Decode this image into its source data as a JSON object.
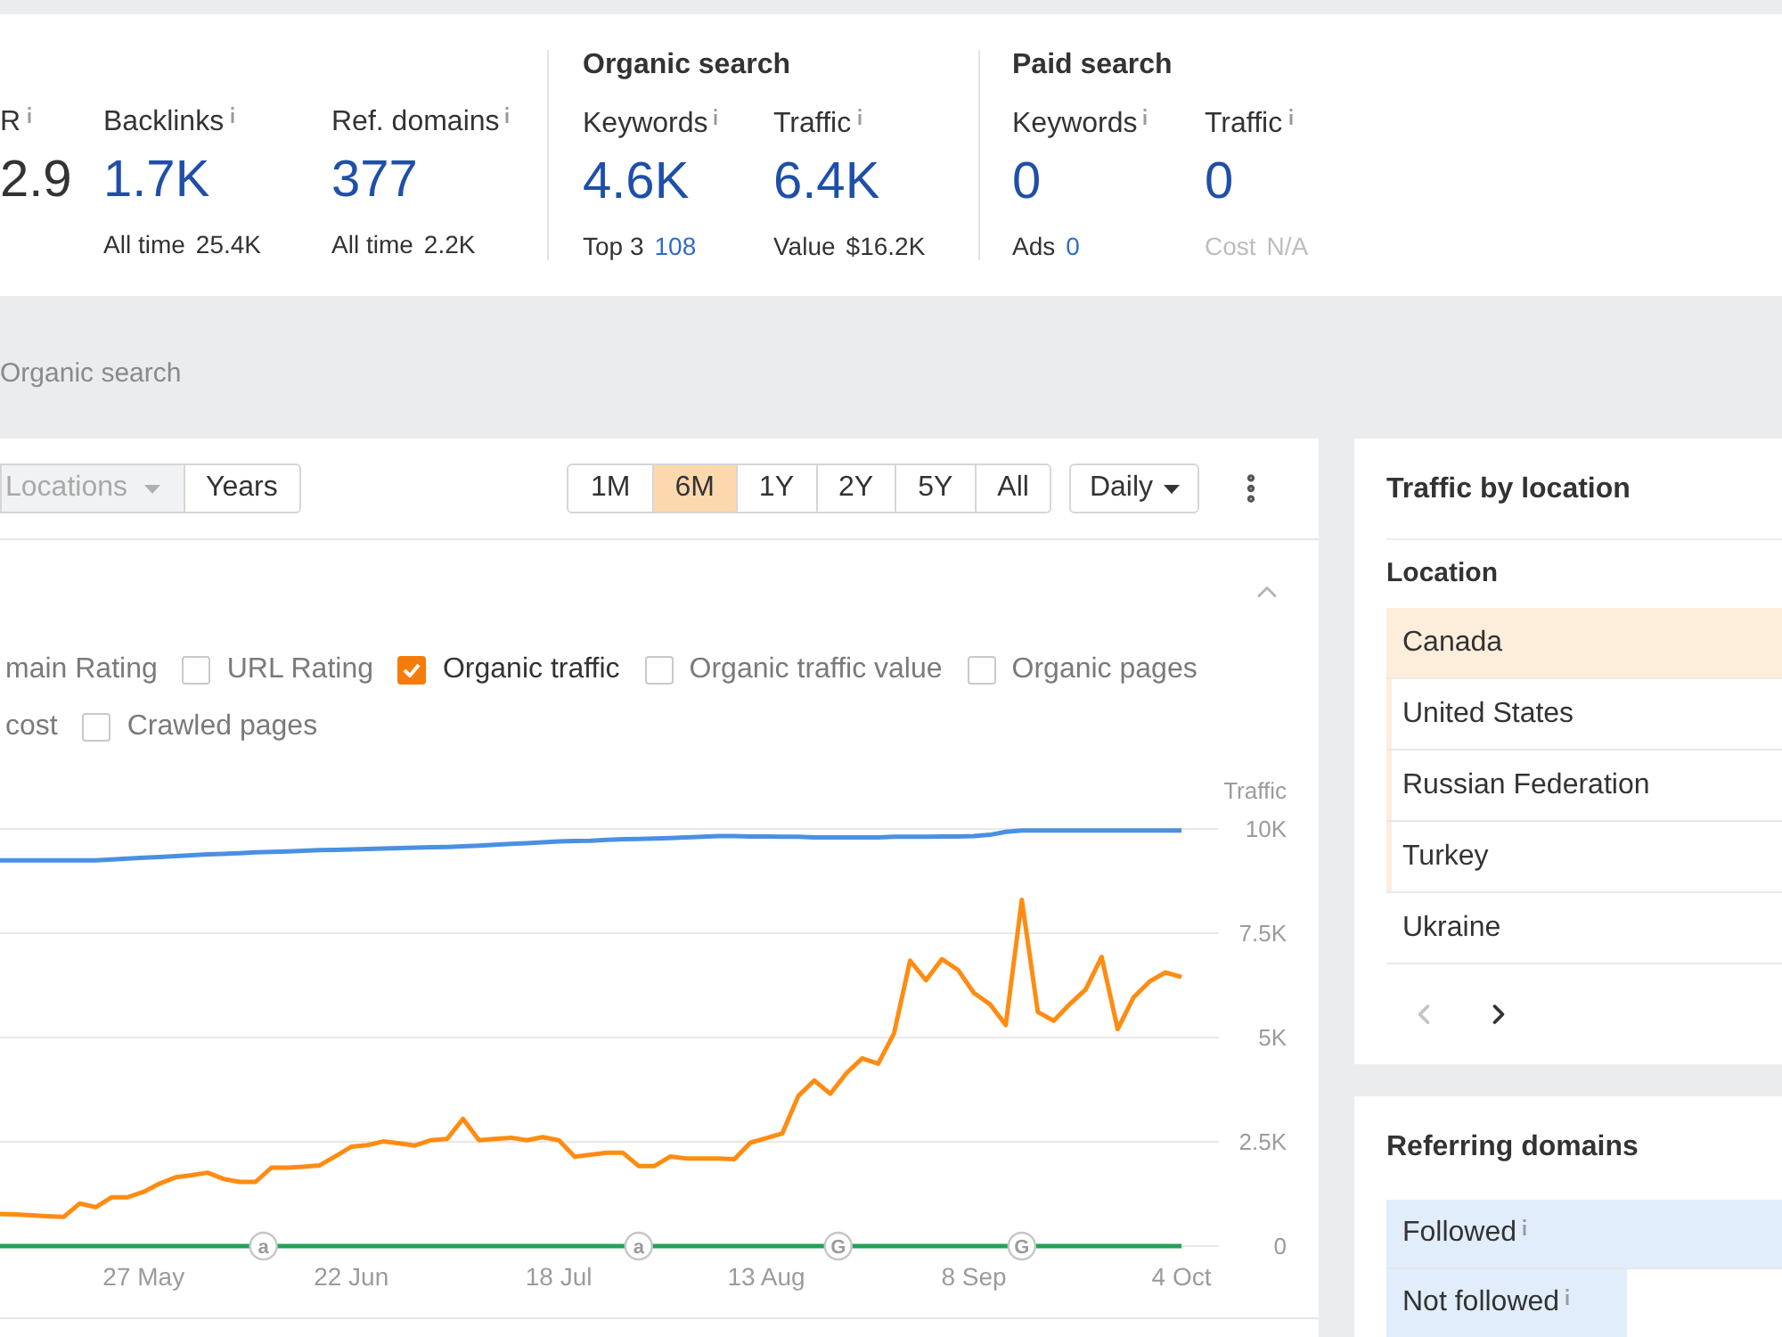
{
  "metrics": {
    "groups": [
      {
        "items": [
          {
            "label": "R",
            "value": "2.9",
            "linked": false
          },
          {
            "label": "Backlinks",
            "value": "1.7K",
            "linked": true,
            "sub": {
              "label": "All time",
              "value": "25.4K",
              "kind": "plain"
            }
          },
          {
            "label": "Ref. domains",
            "value": "377",
            "linked": true,
            "sub": {
              "label": "All time",
              "value": "2.2K",
              "kind": "plain"
            }
          }
        ]
      },
      {
        "title": "Organic search",
        "items": [
          {
            "label": "Keywords",
            "value": "4.6K",
            "linked": true,
            "sub": {
              "label": "Top 3",
              "value": "108",
              "kind": "link"
            }
          },
          {
            "label": "Traffic",
            "value": "6.4K",
            "linked": true,
            "sub": {
              "label": "Value",
              "value": "$16.2K",
              "kind": "plain"
            }
          }
        ]
      },
      {
        "title": "Paid search",
        "items": [
          {
            "label": "Keywords",
            "value": "0",
            "linked": true,
            "sub": {
              "label": "Ads",
              "value": "0",
              "kind": "link"
            }
          },
          {
            "label": "Traffic",
            "value": "0",
            "linked": true,
            "sub": {
              "label": "Cost",
              "value": "N/A",
              "kind": "muted"
            }
          }
        ]
      }
    ]
  },
  "section_title": "Organic search",
  "chart_card": {
    "view_buttons": [
      {
        "label": "Locations",
        "kind": "dropdown",
        "disabled": true
      },
      {
        "label": "Years",
        "kind": "button",
        "disabled": false
      }
    ],
    "ranges": [
      {
        "label": "1M",
        "selected": false
      },
      {
        "label": "6M",
        "selected": true
      },
      {
        "label": "1Y",
        "selected": false
      },
      {
        "label": "2Y",
        "selected": false
      },
      {
        "label": "5Y",
        "selected": false
      },
      {
        "label": "All",
        "selected": false
      }
    ],
    "interval": {
      "label": "Daily"
    },
    "expanded": true,
    "legend_rows": [
      [
        {
          "label": "main Rating",
          "kind": "cut",
          "checked": false
        },
        {
          "label": "URL Rating",
          "kind": "checkbox",
          "checked": false
        },
        {
          "label": "Organic traffic",
          "kind": "checkbox",
          "checked": true
        },
        {
          "label": "Organic traffic value",
          "kind": "checkbox",
          "checked": false
        },
        {
          "label": "Organic pages",
          "kind": "checkbox",
          "checked": false
        }
      ],
      [
        {
          "label": "cost",
          "kind": "cut",
          "checked": false
        },
        {
          "label": "Crawled pages",
          "kind": "checkbox",
          "checked": false
        }
      ]
    ],
    "chart_data": {
      "type": "line",
      "ylabel": "Traffic",
      "grid": true,
      "categories": [
        null,
        null,
        null,
        null,
        null,
        null,
        null,
        null,
        null,
        "27 May",
        null,
        null,
        null,
        null,
        null,
        null,
        null,
        null,
        null,
        null,
        null,
        null,
        "22 Jun",
        null,
        null,
        null,
        null,
        null,
        null,
        null,
        null,
        null,
        null,
        null,
        null,
        "18 Jul",
        null,
        null,
        null,
        null,
        null,
        null,
        null,
        null,
        null,
        null,
        null,
        null,
        "13 Aug",
        null,
        null,
        null,
        null,
        null,
        null,
        null,
        null,
        null,
        null,
        null,
        null,
        "8 Sep",
        null,
        null,
        null,
        null,
        null,
        null,
        null,
        null,
        null,
        null,
        null,
        null,
        "4 Oct"
      ],
      "series": [
        {
          "color": "#4a90e2",
          "values": [
            9250,
            9250,
            9250,
            9250,
            9250,
            9250,
            9250,
            9270,
            9290,
            9310,
            9330,
            9350,
            9370,
            9390,
            9400,
            9420,
            9440,
            9450,
            9460,
            9480,
            9490,
            9500,
            9510,
            9520,
            9530,
            9540,
            9550,
            9560,
            9570,
            9580,
            9600,
            9620,
            9640,
            9660,
            9680,
            9700,
            9710,
            9720,
            9740,
            9750,
            9760,
            9770,
            9780,
            9800,
            9810,
            9830,
            9830,
            9820,
            9820,
            9810,
            9810,
            9800,
            9800,
            9800,
            9800,
            9800,
            9810,
            9810,
            9810,
            9820,
            9820,
            9830,
            9860,
            9930,
            9960,
            9960,
            9960,
            9960,
            9960,
            9960,
            9960,
            9960,
            9960,
            9960,
            9960
          ]
        },
        {
          "color": "#ff8c12",
          "values": [
            770,
            760,
            740,
            720,
            700,
            1020,
            930,
            1170,
            1170,
            1300,
            1500,
            1650,
            1700,
            1760,
            1610,
            1540,
            1540,
            1880,
            1880,
            1900,
            1930,
            2150,
            2380,
            2420,
            2510,
            2460,
            2410,
            2540,
            2570,
            3050,
            2540,
            2570,
            2600,
            2540,
            2610,
            2540,
            2140,
            2190,
            2240,
            2240,
            1920,
            1920,
            2150,
            2100,
            2100,
            2100,
            2080,
            2480,
            2590,
            2700,
            3600,
            3970,
            3650,
            4140,
            4500,
            4370,
            5100,
            6840,
            6370,
            6880,
            6620,
            6070,
            5800,
            5300,
            8300,
            5610,
            5400,
            5800,
            6150,
            6930,
            5200,
            5960,
            6340,
            6560,
            6450
          ]
        },
        {
          "color": "#23a15a",
          "values": [
            0,
            0,
            0,
            0,
            0,
            0,
            0,
            0,
            0,
            0,
            0,
            0,
            0,
            0,
            0,
            0,
            0,
            0,
            0,
            0,
            0,
            0,
            0,
            0,
            0,
            0,
            0,
            0,
            0,
            0,
            0,
            0,
            0,
            0,
            0,
            0,
            0,
            0,
            0,
            0,
            0,
            0,
            0,
            0,
            0,
            0,
            0,
            0,
            0,
            0,
            0,
            0,
            0,
            0,
            0,
            0,
            0,
            0,
            0,
            0,
            0,
            0,
            0,
            0,
            0,
            0,
            0,
            0,
            0,
            0,
            0,
            0,
            0,
            0,
            0
          ]
        }
      ],
      "ylim": [
        0,
        10000
      ],
      "yticks": [
        {
          "value": 0,
          "label": "0"
        },
        {
          "value": 2500,
          "label": "2.5K"
        },
        {
          "value": 5000,
          "label": "5K"
        },
        {
          "value": 7500,
          "label": "7.5K"
        },
        {
          "value": 10000,
          "label": "10K"
        }
      ]
    },
    "event_markers": [
      {
        "text": "a"
      },
      {
        "text": "a"
      },
      {
        "text": "G"
      },
      {
        "text": "G"
      }
    ]
  },
  "traffic_by_location": {
    "title": "Traffic by location",
    "column": "Location",
    "rows": [
      {
        "name": "Canada",
        "level": 1
      },
      {
        "name": "United States",
        "level": 0.015
      },
      {
        "name": "Russian Federation",
        "level": 0.015
      },
      {
        "name": "Turkey",
        "level": 0.015
      },
      {
        "name": "Ukraine"
      }
    ],
    "pagination": {
      "prev_disabled": true,
      "next_disabled": false
    }
  },
  "referring_domains": {
    "title": "Referring domains",
    "rows": [
      {
        "label": "Followed",
        "level": 1
      },
      {
        "label": "Not followed",
        "level": 0.61
      }
    ]
  }
}
